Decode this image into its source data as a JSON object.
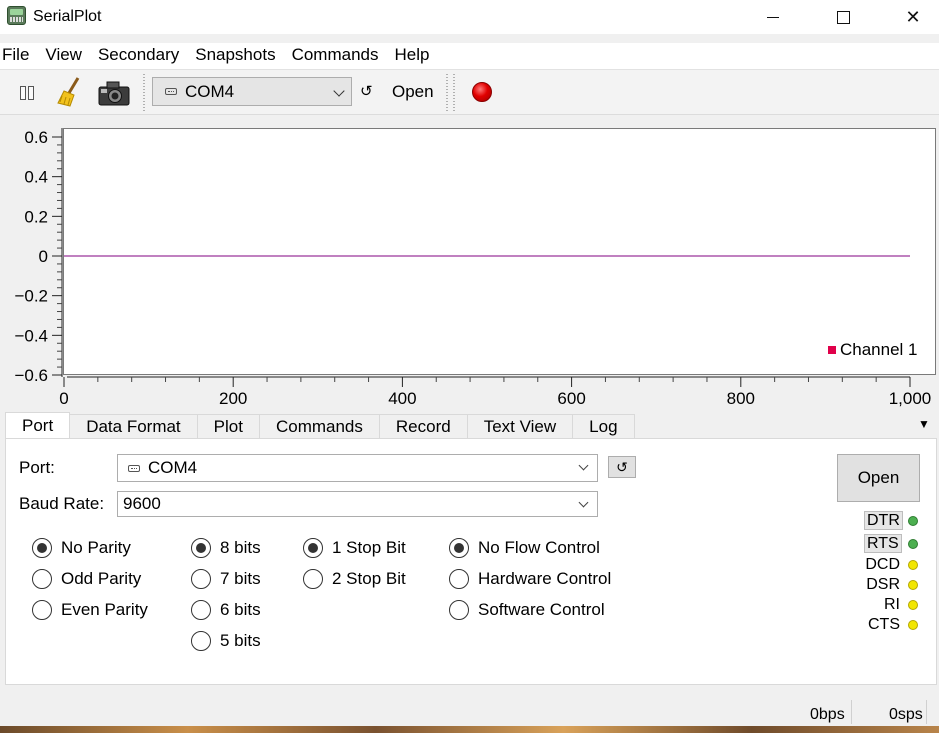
{
  "window": {
    "title": "SerialPlot"
  },
  "menu": [
    "File",
    "View",
    "Secondary",
    "Snapshots",
    "Commands",
    "Help"
  ],
  "toolbar": {
    "icons": [
      "pause-icon",
      "clear-broom-icon",
      "snapshot-camera-icon",
      "refresh-icon",
      "record-icon"
    ],
    "port_value": "COM4",
    "refresh_glyph": "↺",
    "open_label": "Open",
    "record_color": "#e10000"
  },
  "chart_data": {
    "type": "line",
    "title": "",
    "xlabel": "",
    "ylabel": "",
    "xlim": [
      0,
      1000
    ],
    "ylim": [
      -0.6,
      0.6
    ],
    "x_ticks": [
      "0",
      "200",
      "400",
      "600",
      "800",
      "1,000"
    ],
    "y_ticks": [
      "0.6",
      "0.4",
      "0.2",
      "0",
      "−0.2",
      "−0.4",
      "−0.6"
    ],
    "series": [
      {
        "name": "Channel 1",
        "color": "#800080",
        "x": [
          0,
          1000
        ],
        "y": [
          0,
          0
        ]
      }
    ],
    "legend": {
      "position": "bottom-right",
      "swatch_color": "#e0004a"
    },
    "grid": false
  },
  "tabs": [
    "Port",
    "Data Format",
    "Plot",
    "Commands",
    "Record",
    "Text View",
    "Log"
  ],
  "active_tab": "Port",
  "port_panel": {
    "port_label": "Port:",
    "port_value": "COM4",
    "refresh_glyph": "↺",
    "baud_label": "Baud Rate:",
    "baud_value": "9600",
    "open_label": "Open",
    "parity": [
      {
        "label": "No Parity",
        "checked": true
      },
      {
        "label": "Odd Parity",
        "checked": false
      },
      {
        "label": "Even Parity",
        "checked": false
      }
    ],
    "data_bits": [
      {
        "label": "8 bits",
        "checked": true
      },
      {
        "label": "7 bits",
        "checked": false
      },
      {
        "label": "6 bits",
        "checked": false
      },
      {
        "label": "5 bits",
        "checked": false
      }
    ],
    "stop_bits": [
      {
        "label": "1 Stop Bit",
        "checked": true
      },
      {
        "label": "2 Stop Bit",
        "checked": false
      }
    ],
    "flow_control": [
      {
        "label": "No Flow Control",
        "checked": true
      },
      {
        "label": "Hardware Control",
        "checked": false
      },
      {
        "label": "Software Control",
        "checked": false
      }
    ],
    "signals": [
      {
        "label": "DTR",
        "led": "#4caf50"
      },
      {
        "label": "RTS",
        "led": "#4caf50"
      },
      {
        "label": "DCD",
        "led": "#f2e600"
      },
      {
        "label": "DSR",
        "led": "#f2e600"
      },
      {
        "label": "RI",
        "led": "#f2e600"
      },
      {
        "label": "CTS",
        "led": "#f2e600"
      }
    ]
  },
  "status": {
    "bps": "0bps",
    "sps": "0sps"
  }
}
